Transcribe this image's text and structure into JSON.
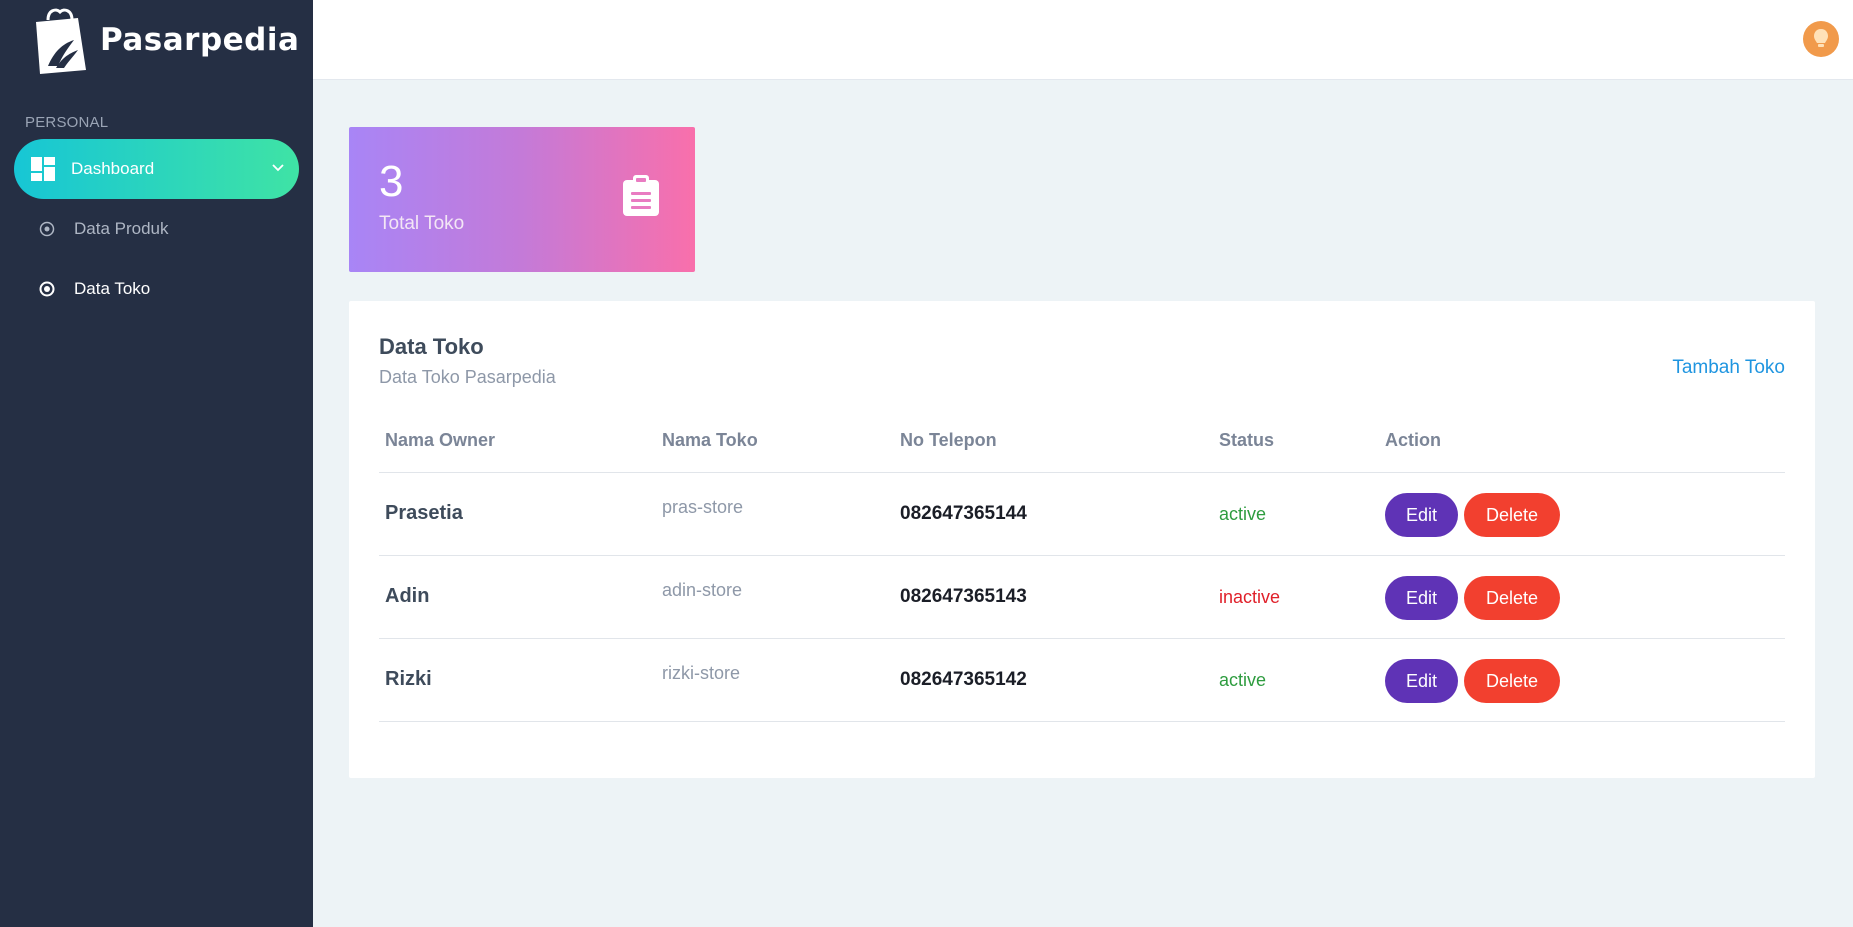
{
  "brand": {
    "name": "Pasarpedia",
    "logo_icon": "shopping-bag-leaf-logo"
  },
  "sidebar": {
    "section_label": "PERSONAL",
    "items": [
      {
        "label": "Dashboard",
        "icon": "dashboard-icon",
        "state": "expanded"
      },
      {
        "label": "Data Produk",
        "icon": "radio-dot-icon"
      },
      {
        "label": "Data Toko",
        "icon": "radio-dot-icon"
      }
    ]
  },
  "topbar": {
    "avatar_icon": "user-avatar"
  },
  "stat": {
    "value": "3",
    "caption": "Total Toko",
    "icon": "clipboard-icon"
  },
  "table_card": {
    "title": "Data Toko",
    "subtitle": "Data Toko Pasarpedia",
    "add_link": "Tambah Toko",
    "columns": [
      "Nama Owner",
      "Nama Toko",
      "No Telepon",
      "Status",
      "Action"
    ],
    "rows": [
      {
        "owner": "Prasetia",
        "store": "pras-store",
        "phone": "082647365144",
        "status": "active",
        "edit": "Edit",
        "delete": "Delete"
      },
      {
        "owner": "Adin",
        "store": "adin-store",
        "phone": "082647365143",
        "status": "inactive",
        "edit": "Edit",
        "delete": "Delete"
      },
      {
        "owner": "Rizki",
        "store": "rizki-store",
        "phone": "082647365142",
        "status": "active",
        "edit": "Edit",
        "delete": "Delete"
      }
    ]
  },
  "colors": {
    "sidebar_bg": "#252f44",
    "nav_active_gradient": [
      "#17c6d5",
      "#3fe3a5"
    ],
    "stat_gradient": [
      "#a885f6",
      "#f96fab"
    ],
    "edit_button": "#5f33b6",
    "delete_button": "#f2402f",
    "status_active": "#2e9c3f",
    "status_inactive": "#e0202a",
    "link": "#1f95e0"
  }
}
